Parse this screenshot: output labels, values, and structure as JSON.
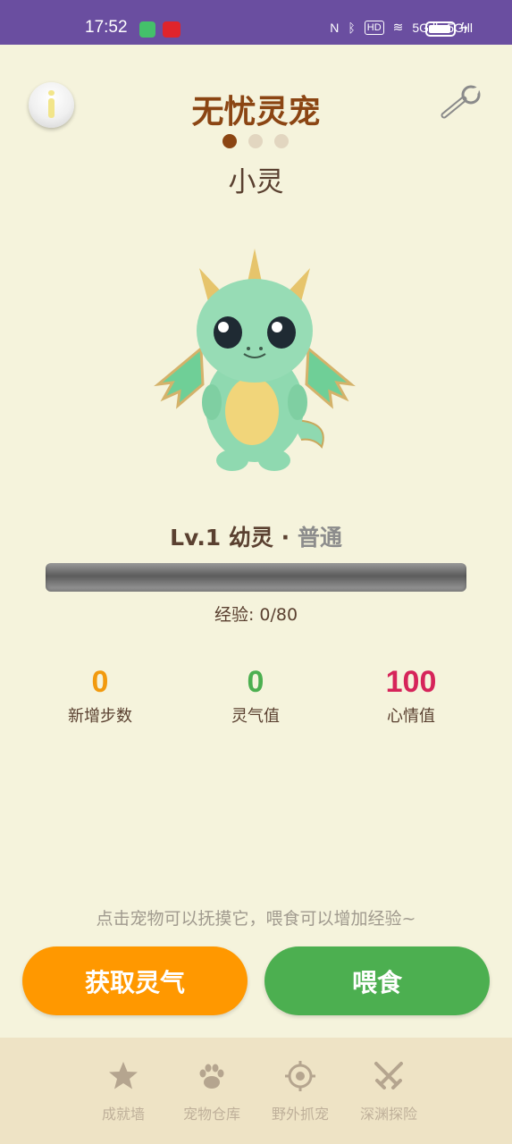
{
  "status_bar": {
    "time": "17:52",
    "network_1": "5G",
    "network_2": "5G",
    "hd_label": "HD"
  },
  "header": {
    "title": "无忧灵宠",
    "info_icon": "info-icon",
    "settings_icon": "wrench-icon",
    "page_dots": 3,
    "active_dot": 1
  },
  "pet": {
    "name": "小灵",
    "image": "baby-dragon-illustration",
    "level_text": "Lv.1 幼灵",
    "separator": "·",
    "rarity": "普通",
    "xp_label": "经验: 0/80",
    "xp_progress": 0
  },
  "stats": [
    {
      "value": "0",
      "label": "新增步数",
      "color": "#f29a0e"
    },
    {
      "value": "0",
      "label": "灵气值",
      "color": "#4caf50"
    },
    {
      "value": "100",
      "label": "心情值",
      "color": "#d6245a"
    }
  ],
  "hint": "点击宠物可以抚摸它，喂食可以增加经验~",
  "actions": {
    "gather_label": "获取灵气",
    "feed_label": "喂食"
  },
  "nav": [
    {
      "label": "成就墙",
      "icon": "star-icon"
    },
    {
      "label": "宠物仓库",
      "icon": "paw-icon"
    },
    {
      "label": "野外抓宠",
      "icon": "target-icon"
    },
    {
      "label": "深渊探险",
      "icon": "crossed-swords-icon"
    }
  ],
  "colors": {
    "background": "#f5f3dc",
    "status_bar": "#6a4ea0",
    "title": "#8b4513",
    "orange_button": "#ff9800",
    "green_button": "#4caf50",
    "nav_background": "#eee3c5"
  }
}
